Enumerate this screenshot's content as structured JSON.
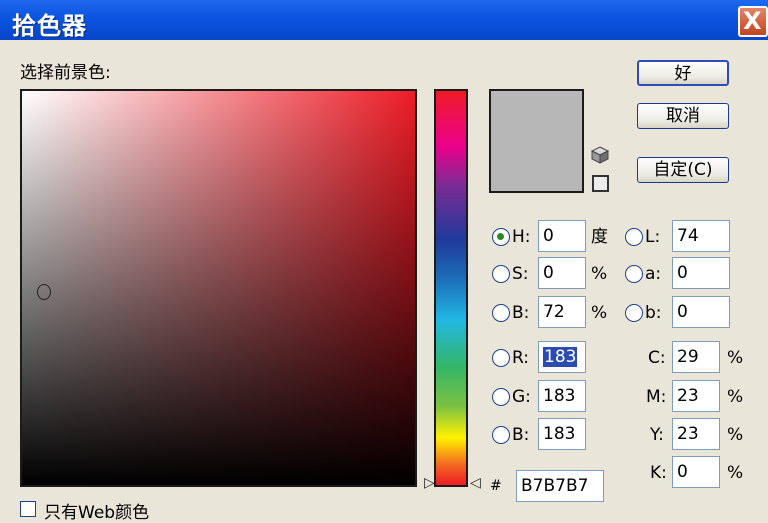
{
  "window": {
    "title": "拾色器",
    "close_glyph": "X"
  },
  "picker": {
    "label": "选择前景色:"
  },
  "preview": {
    "color": "#b7b7b7"
  },
  "buttons": {
    "ok": "好",
    "cancel": "取消",
    "custom": "自定(C)"
  },
  "hsb": [
    {
      "key": "H",
      "label": "H:",
      "value": "0",
      "unit": "度",
      "selected": true
    },
    {
      "key": "S",
      "label": "S:",
      "value": "0",
      "unit": "%",
      "selected": false
    },
    {
      "key": "B",
      "label": "B:",
      "value": "72",
      "unit": "%",
      "selected": false
    }
  ],
  "lab": [
    {
      "key": "L",
      "label": "L:",
      "value": "74"
    },
    {
      "key": "a",
      "label": "a:",
      "value": "0"
    },
    {
      "key": "b",
      "label": "b:",
      "value": "0"
    }
  ],
  "rgb": [
    {
      "key": "R",
      "label": "R:",
      "value": "183",
      "highlighted": true
    },
    {
      "key": "G",
      "label": "G:",
      "value": "183"
    },
    {
      "key": "B",
      "label": "B:",
      "value": "183"
    }
  ],
  "cmyk": [
    {
      "key": "C",
      "label": "C:",
      "value": "29",
      "unit": "%"
    },
    {
      "key": "M",
      "label": "M:",
      "value": "23",
      "unit": "%"
    },
    {
      "key": "Y",
      "label": "Y:",
      "value": "23",
      "unit": "%"
    },
    {
      "key": "K",
      "label": "K:",
      "value": "0",
      "unit": "%"
    }
  ],
  "hex": {
    "symbol": "#",
    "value": "B7B7B7"
  },
  "web_only": {
    "label": "只有Web颜色"
  },
  "icons": {
    "cube": "gamut-warning-cube-icon",
    "square": "web-safe-square-icon",
    "arrow_left": "▷",
    "arrow_right": "◁"
  }
}
